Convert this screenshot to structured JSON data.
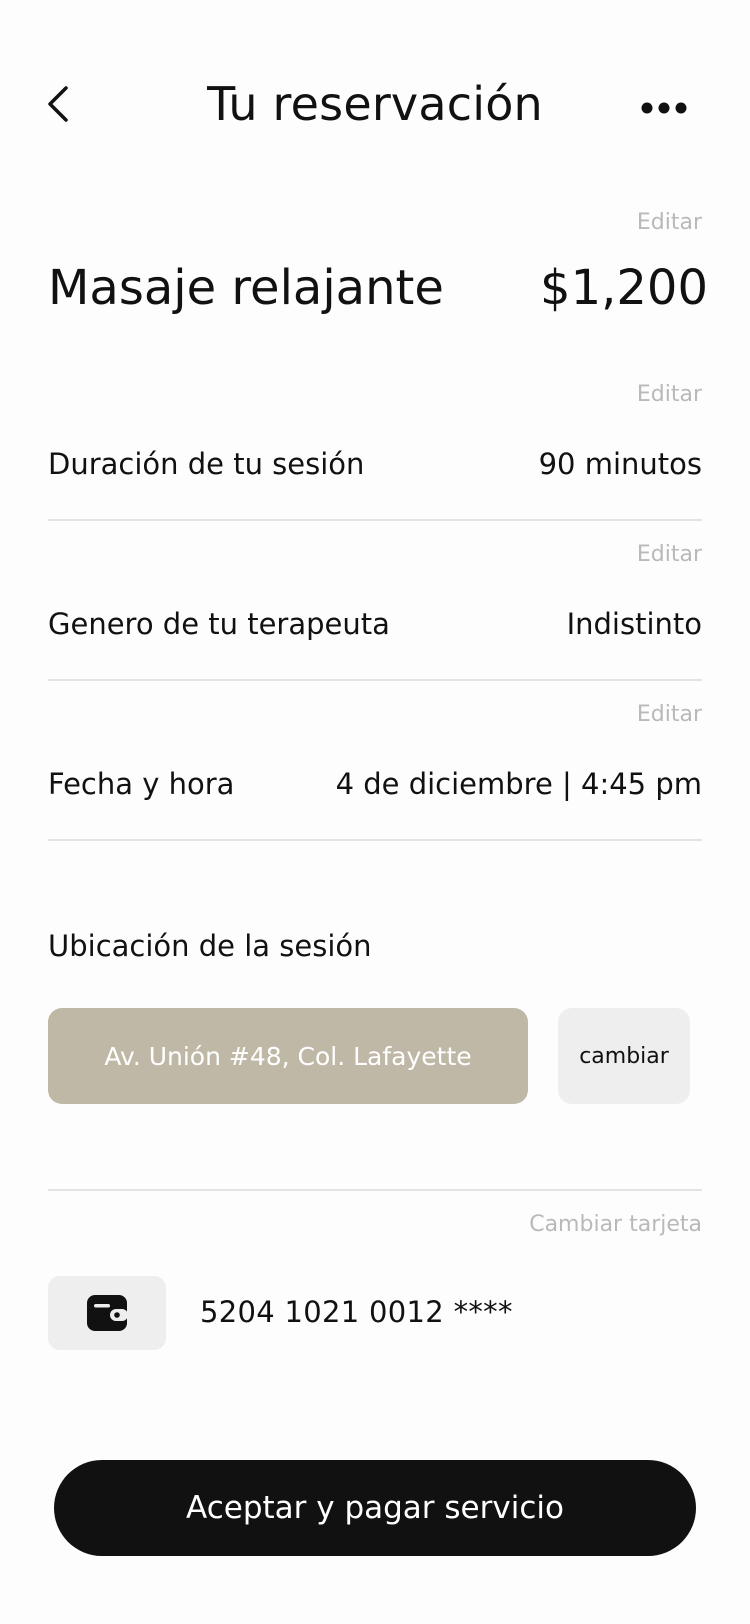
{
  "header": {
    "title": "Tu reservación",
    "back_icon": "chevron-left-icon",
    "more_icon": "more-horizontal-icon"
  },
  "service": {
    "edit_label": "Editar",
    "name": "Masaje relajante",
    "price": "$1,200"
  },
  "details": [
    {
      "edit_label": "Editar",
      "label": "Duración de tu sesión",
      "value": "90 minutos"
    },
    {
      "edit_label": "Editar",
      "label": "Genero de tu terapeuta",
      "value": "Indistinto"
    },
    {
      "edit_label": "Editar",
      "label": "Fecha y hora",
      "value": "4 de diciembre | 4:45 pm"
    }
  ],
  "location": {
    "title": "Ubicación de la sesión",
    "address": "Av. Unión #48, Col. Lafayette",
    "change_label": "cambiar"
  },
  "payment": {
    "change_card_label": "Cambiar tarjeta",
    "card_icon": "wallet-icon",
    "card_number": "5204 1021 0012 ****"
  },
  "cta": {
    "label": "Aceptar y pagar servicio"
  },
  "colors": {
    "accent_address": "#c0b8a6",
    "button_dark": "#111111",
    "muted_text": "#b9b9b9"
  }
}
